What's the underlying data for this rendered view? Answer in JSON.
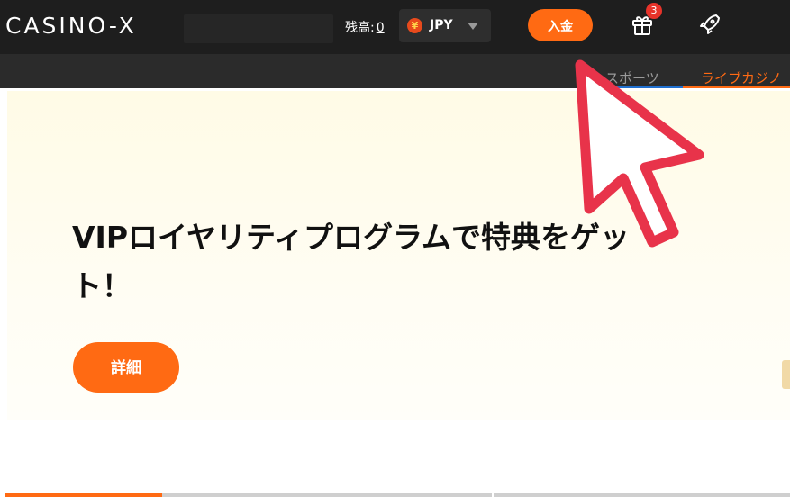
{
  "header": {
    "logo": "CASINO-X",
    "balance_label": "残高:",
    "balance_value": "0",
    "currency_symbol": "¥",
    "currency_code": "JPY",
    "deposit_label": "入金",
    "gift_badge_count": "3"
  },
  "subnav": {
    "tabs": [
      {
        "label": "スポーツ",
        "accent": "#1f6fcf"
      },
      {
        "label": "ライブカジノ",
        "accent": "#ff6a13"
      }
    ]
  },
  "hero": {
    "title": "VIPロイヤリティプログラムで特典をゲット！",
    "details_label": "詳細"
  },
  "colors": {
    "brand_orange": "#ff6a13",
    "header_bg": "#1e1e1e",
    "subnav_bg": "#2b2b2b",
    "cursor_red": "#e8334a"
  },
  "icons": [
    "yen-icon",
    "chevron-down-icon",
    "gift-icon",
    "rocket-icon",
    "pointer-cursor-icon"
  ]
}
